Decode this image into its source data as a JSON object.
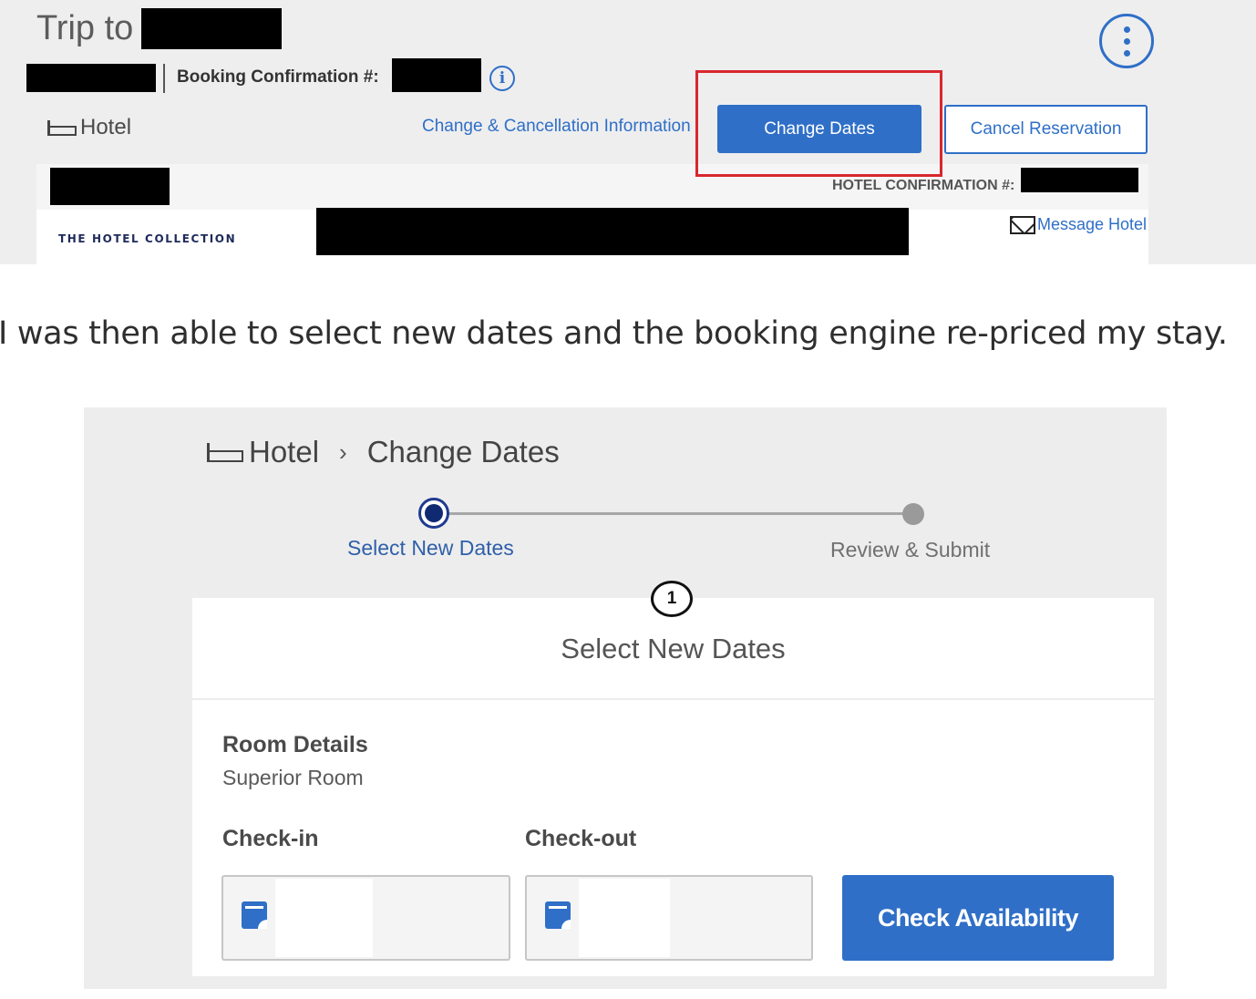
{
  "trip": {
    "title_prefix": "Trip to",
    "booking_confirmation_label": "Booking Confirmation #:",
    "product_label": "Hotel",
    "change_cancel_link": "Change & Cancellation Information",
    "change_dates_button": "Change Dates",
    "cancel_button": "Cancel Reservation",
    "hotel_confirmation_label": "HOTEL CONFIRMATION #:",
    "hotel_collection_logo": "THE HOTEL COLLECTION",
    "message_hotel_link": "Message Hotel"
  },
  "caption": "I was then able to select new dates and the booking engine re-priced my stay.",
  "change_dates": {
    "breadcrumb": {
      "root": "Hotel",
      "current": "Change Dates"
    },
    "steps": [
      {
        "label": "Select New Dates",
        "active": true
      },
      {
        "label": "Review & Submit",
        "active": false
      }
    ],
    "step_number": "1",
    "panel_title": "Select New Dates",
    "room_details_heading": "Room Details",
    "room_type": "Superior Room",
    "checkin_label": "Check-in",
    "checkout_label": "Check-out",
    "checkin_value": "",
    "checkout_value": "",
    "check_availability_button": "Check Availability"
  },
  "colors": {
    "accent_blue": "#2f6fc7",
    "highlight_red": "#d9272e",
    "step_active": "#102a72"
  }
}
